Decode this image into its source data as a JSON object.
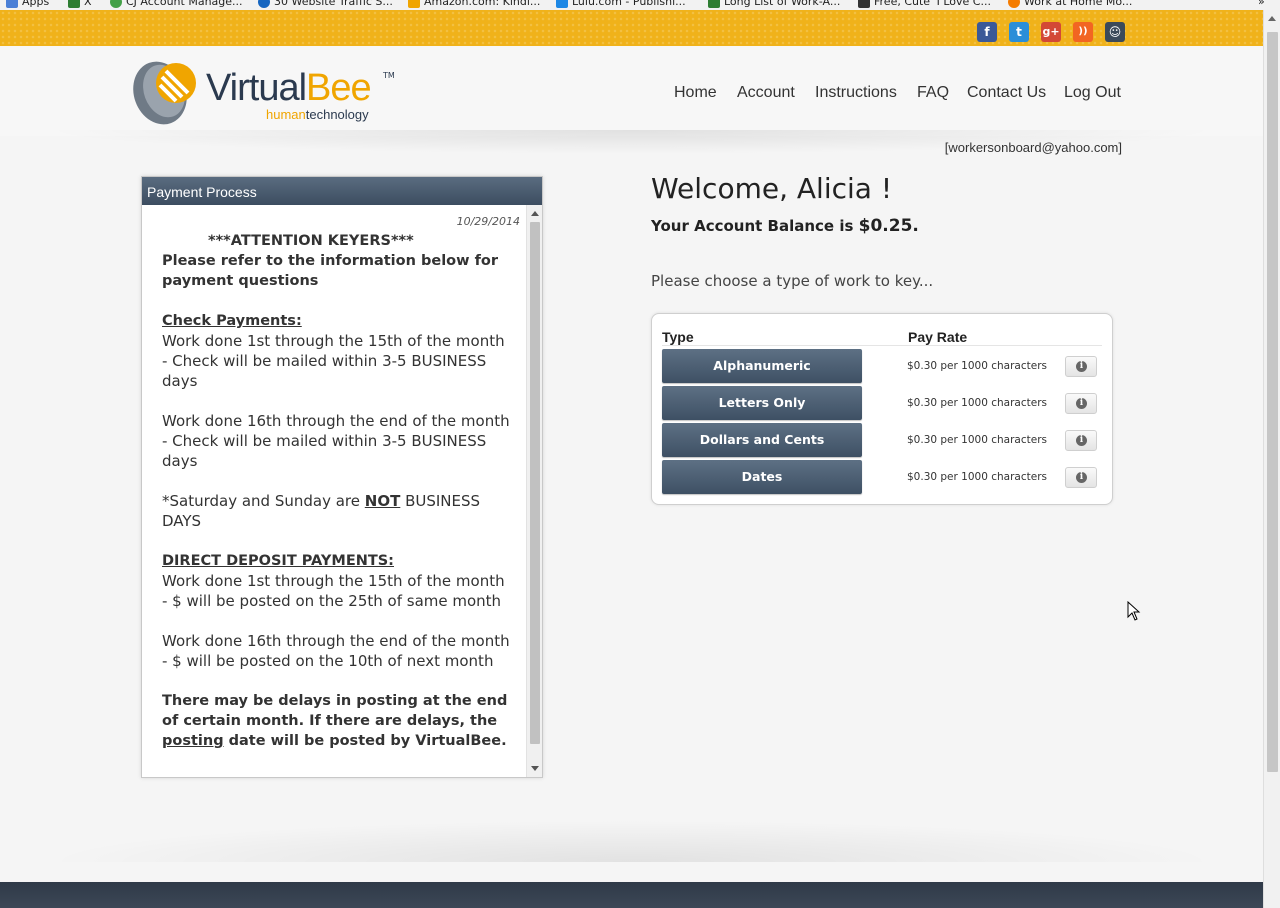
{
  "bookmarks": {
    "items": [
      {
        "label": "Apps",
        "color": "#4a7fd6"
      },
      {
        "label": "X",
        "color": "#2e7d32"
      },
      {
        "label": "CJ Account Manage...",
        "color": "#43a047"
      },
      {
        "label": "30 Website Traffic S...",
        "color": "#1565c0"
      },
      {
        "label": "Amazon.com: Kindl...",
        "color": "#f0a500"
      },
      {
        "label": "Lulu.com - Publishi...",
        "color": "#1e88e5"
      },
      {
        "label": "Long List of Work-A...",
        "color": "#2e7d32"
      },
      {
        "label": "Free, Cute 'I Love C...",
        "color": "#333333"
      },
      {
        "label": "Work at Home Mo...",
        "color": "#f57c00"
      }
    ],
    "overflow": "»"
  },
  "social": {
    "items": [
      {
        "name": "facebook-icon",
        "glyph": "f",
        "color": "#3b5998"
      },
      {
        "name": "twitter-icon",
        "glyph": "t",
        "color": "#2a8ed8"
      },
      {
        "name": "google-plus-icon",
        "glyph": "g+",
        "color": "#d34836"
      },
      {
        "name": "rss-icon",
        "glyph": "))",
        "color": "#f26522"
      },
      {
        "name": "community-icon",
        "glyph": "☺",
        "color": "#3b4a5a"
      }
    ]
  },
  "logo": {
    "virtual": "Virtual",
    "bee": "Bee",
    "tm": "TM",
    "tag_human": "human",
    "tag_tech": "technology"
  },
  "nav": {
    "home": "Home",
    "account": "Account",
    "instructions": "Instructions",
    "faq": "FAQ",
    "contact": "Contact Us",
    "logout": "Log Out"
  },
  "user": {
    "email": "[workersonboard@yahoo.com]"
  },
  "payment_panel": {
    "title": "Payment Process",
    "date": "10/29/2014",
    "attention": "***ATTENTION  KEYERS***",
    "intro": "Please refer to the information below for payment questions",
    "check_heading": "Check Payments:",
    "check_1": "Work done 1st through the 15th of the month - Check will be mailed within 3-5 BUSINESS days",
    "check_2": "Work done 16th through the end of the month - Check will be mailed within 3-5 BUSINESS days",
    "weekend_pre": "*Saturday and Sunday are ",
    "weekend_not": "NOT",
    "weekend_post": " BUSINESS DAYS",
    "dd_heading": "DIRECT DEPOSIT PAYMENTS:",
    "dd_1": "Work done 1st through the 15th of the month - $ will be posted on the 25th of same month",
    "dd_2": "Work done 16th through the end of the month - $ will be posted on the 10th of next month",
    "delay_pre": "There may be delays in posting at the end of certain month.  If there are delays, the ",
    "delay_link": "posting",
    "delay_post": " date will be posted by VirtualBee."
  },
  "main": {
    "welcome": "Welcome, Alicia !",
    "balance_label": "Your Account Balance is ",
    "balance_amount": "$0.25.",
    "choose": "Please choose a type of work to key..."
  },
  "work_table": {
    "col_type": "Type",
    "col_rate": "Pay Rate",
    "rows": [
      {
        "type": "Alphanumeric",
        "rate": "$0.30 per 1000 characters"
      },
      {
        "type": "Letters Only",
        "rate": "$0.30 per 1000 characters"
      },
      {
        "type": "Dollars and Cents",
        "rate": "$0.30 per 1000 characters"
      },
      {
        "type": "Dates",
        "rate": "$0.30 per 1000 characters"
      }
    ],
    "info_glyph": "i"
  }
}
